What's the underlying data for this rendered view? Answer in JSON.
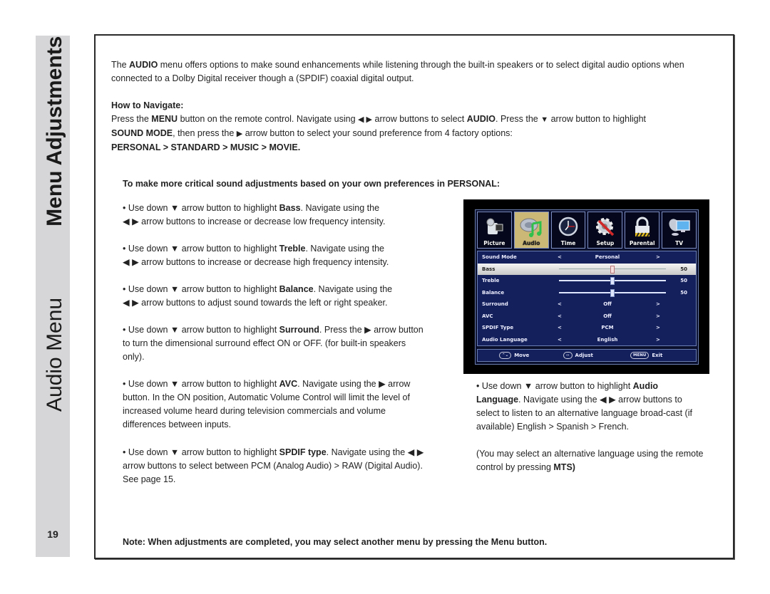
{
  "sidebar": {
    "section_light": "Audio Menu",
    "section_bold": "Menu Adjustments",
    "page_number": "19"
  },
  "intro": {
    "t1": "The ",
    "b1": "AUDIO",
    "t2": " menu offers options to make sound enhancements while listening through the built-in speakers or to select digital audio options when connected to a Dolby Digital receiver though a (SPDIF) coaxial digital output."
  },
  "navigate": {
    "heading": "How to Navigate:",
    "t1": "Press the ",
    "b1": "MENU",
    "t2": " button on the remote control. Navigate using ",
    "arrows_lr": "◀ ▶",
    "t3": " arrow buttons to select ",
    "b2": "AUDIO",
    "t4": ". Press the ",
    "arrow_down": "▼",
    "t5": " arrow button to highlight ",
    "b3": "SOUND MODE",
    "t6": ", then press the ",
    "arrow_right": "▶",
    "t7": " arrow button to select your sound preference from 4 factory options:",
    "options": "PERSONAL > STANDARD > MUSIC > MOVIE."
  },
  "personal_heading": "To make more critical sound adjustments based on your own preferences in PERSONAL:",
  "bullets": [
    {
      "pre": "• Use down ▼ arrow button to highlight ",
      "bold": "Bass",
      "post": ". Navigate using the",
      "line2": " ◀ ▶ arrow buttons to increase or decrease low frequency intensity."
    },
    {
      "pre": "• Use down ▼ arrow button to highlight ",
      "bold": "Treble",
      "post": ". Navigate using the",
      "line2": " ◀ ▶ arrow buttons to increase or decrease high frequency intensity."
    },
    {
      "pre": "• Use down ▼ arrow button to highlight ",
      "bold": "Balance",
      "post": ". Navigate using the",
      "line2": " ◀ ▶ arrow buttons to adjust sound towards the left or right speaker."
    },
    {
      "pre": "• Use down ▼ arrow button to highlight ",
      "bold": "Surround",
      "post": ". Press the ▶ arrow button to turn the dimensional surround effect ON or OFF. (for built-in speakers only)."
    },
    {
      "pre": "• Use down ▼ arrow button to highlight ",
      "bold": "AVC",
      "post": ". Navigate using the ▶ arrow button. In the ON position, Automatic Volume Control will limit the level of increased volume heard during television commercials and volume differences between inputs."
    },
    {
      "pre": "• Use down ▼ arrow button to highlight ",
      "bold": "SPDIF type",
      "post": ". Navigate using the ◀ ▶ arrow buttons to select between PCM (Analog Audio) > RAW (Digital Audio). See page 15."
    }
  ],
  "language_bullet": {
    "pre": "• Use down ▼ arrow button to highlight ",
    "bold": "Audio Language",
    "post": ". Navigate using the ◀ ▶ arrow buttons to select to listen to an alternative language broad-cast (if available)  English > Spanish > French."
  },
  "mts_note": {
    "pre": "(You may select an alternative language using the remote control by pressing ",
    "bold": "MTS)"
  },
  "note": "Note: When adjustments are completed, you may select another menu by pressing the Menu button.",
  "tv_menu": {
    "tabs": [
      {
        "label": "Picture",
        "icon": "camcorder-icon",
        "active": false
      },
      {
        "label": "Audio",
        "icon": "music-note-icon",
        "active": true
      },
      {
        "label": "Time",
        "icon": "clock-icon",
        "active": false
      },
      {
        "label": "Setup",
        "icon": "gear-wrench-icon",
        "active": false
      },
      {
        "label": "Parental",
        "icon": "padlock-icon",
        "active": false
      },
      {
        "label": "TV",
        "icon": "satellite-tv-icon",
        "active": false
      }
    ],
    "rows": [
      {
        "label": "Sound Mode",
        "type": "select",
        "value": "Personal"
      },
      {
        "label": "Bass",
        "type": "slider",
        "value": "50",
        "level": 0.5,
        "highlighted": true
      },
      {
        "label": "Treble",
        "type": "slider",
        "value": "50",
        "level": 0.5
      },
      {
        "label": "Balance",
        "type": "slider",
        "value": "50",
        "level": 0.5
      },
      {
        "label": "Surround",
        "type": "select",
        "value": "Off"
      },
      {
        "label": "AVC",
        "type": "select",
        "value": "Off"
      },
      {
        "label": "SPDIF Type",
        "type": "select",
        "value": "PCM"
      },
      {
        "label": "Audio Language",
        "type": "select",
        "value": "English"
      }
    ],
    "arrow_left": "<",
    "arrow_right": ">",
    "footer": {
      "move_keys": "⌃⌄",
      "move": "Move",
      "adjust_keys": "‹›",
      "adjust": "Adjust",
      "exit_key": "MENU",
      "exit": "Exit"
    }
  }
}
